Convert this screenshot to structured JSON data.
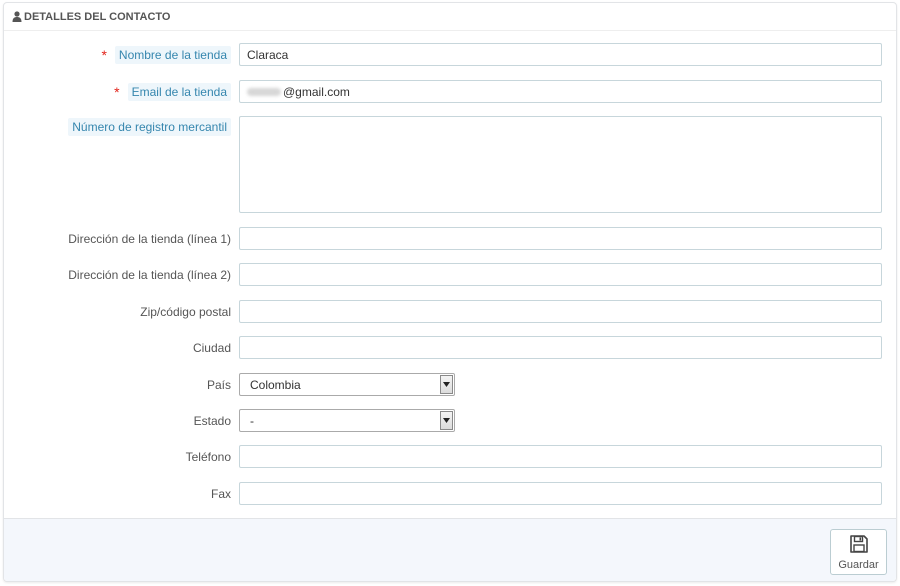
{
  "panel": {
    "title": "DETALLES DEL CONTACTO",
    "title_icon": "user-icon"
  },
  "fields": {
    "shop_name": {
      "label": "Nombre de la tienda",
      "required": "*",
      "value": "Claraca"
    },
    "shop_email": {
      "label": "Email de la tienda",
      "required": "*",
      "value": "@gmail.com"
    },
    "registration_number": {
      "label": "Número de registro mercantil",
      "value": ""
    },
    "address1": {
      "label": "Dirección de la tienda (línea 1)",
      "value": ""
    },
    "address2": {
      "label": "Dirección de la tienda (línea 2)",
      "value": ""
    },
    "zip": {
      "label": "Zip/código postal",
      "value": ""
    },
    "city": {
      "label": "Ciudad",
      "value": ""
    },
    "country": {
      "label": "País",
      "selected": "Colombia"
    },
    "state": {
      "label": "Estado",
      "selected": "-"
    },
    "phone": {
      "label": "Teléfono",
      "value": ""
    },
    "fax": {
      "label": "Fax",
      "value": ""
    }
  },
  "footer": {
    "save_label": "Guardar",
    "save_icon": "floppy-disk-icon"
  }
}
